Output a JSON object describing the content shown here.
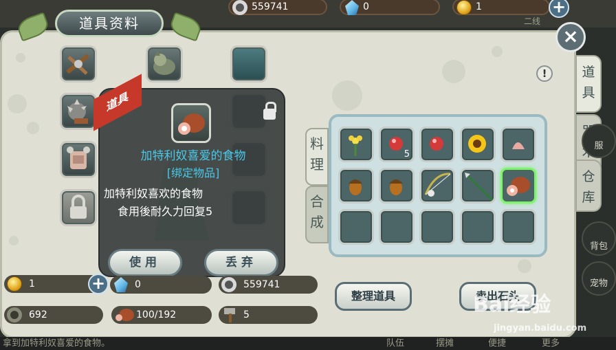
{
  "topbar": {
    "silver": "559741",
    "gems": "0",
    "gold": "1",
    "server": "二线",
    "plus": "+"
  },
  "window": {
    "title": "道具资料",
    "close": "×",
    "info": "!"
  },
  "side_tabs": [
    {
      "label": "道具"
    },
    {
      "label": "咒术"
    },
    {
      "label": "仓库"
    }
  ],
  "sub_tabs": [
    {
      "label": "料理"
    },
    {
      "label": "合成"
    }
  ],
  "tooltip": {
    "tag": "道具",
    "name": "加特利奴喜爱的食物",
    "binding": "[绑定物品]",
    "desc1": "加特利奴喜欢的食物",
    "desc2": "食用後耐久力回复5",
    "use": "使用",
    "discard": "丢弃"
  },
  "bag": {
    "items": [
      {
        "icon": "flower-icon",
        "qty": ""
      },
      {
        "icon": "red-gem-icon",
        "qty": "5"
      },
      {
        "icon": "red-gem-icon",
        "qty": ""
      },
      {
        "icon": "sunflower-icon",
        "qty": ""
      },
      {
        "icon": "shell-icon",
        "qty": ""
      },
      {
        "icon": "acorn-icon",
        "qty": ""
      },
      {
        "icon": "acorn-icon",
        "qty": ""
      },
      {
        "icon": "bow-icon",
        "qty": ""
      },
      {
        "icon": "spear-icon",
        "qty": ""
      },
      {
        "icon": "meat-icon",
        "qty": ""
      }
    ]
  },
  "stats": {
    "gold": "1",
    "gems": "0",
    "silver": "559741",
    "ore": "692",
    "food": "100/192",
    "hammer": "5"
  },
  "buttons": {
    "sort": "整理道具",
    "sell": "卖出石头"
  },
  "bottom": {
    "message": "拿到加特利奴喜爱的食物。",
    "nav1": "队伍",
    "nav2": "摆摊",
    "nav3": "便捷",
    "nav4": "更多"
  },
  "right_nav": {
    "pet": "宠物",
    "bag": "背包",
    "clothes": "服"
  },
  "watermark": {
    "brand": "Bai经验",
    "url": "jingyan.baidu.com"
  },
  "colors": {
    "accent": "#c6392a",
    "item_name": "#49c8e8",
    "selected": "#7ff36a"
  }
}
